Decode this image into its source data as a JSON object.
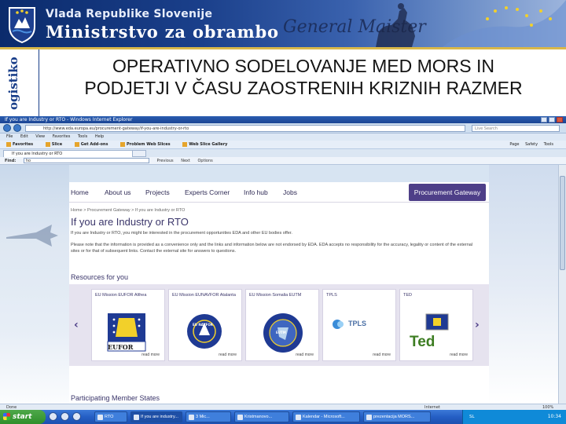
{
  "banner": {
    "government": "Vlada Republike Slovenije",
    "ministry": "Ministrstvo za obrambo",
    "general": "General Maister"
  },
  "slide": {
    "vertical_label": "ogistiko",
    "title_line1": "OPERATIVNO SODELOVANJE  MED MORS IN",
    "title_line2": "PODJETJI V ČASU ZAOSTRENIH KRIZNIH RAZMER"
  },
  "browser": {
    "window_title": "If you are Industry or RTO - Windows Internet Explorer",
    "url": "http://www.eda.europa.eu/procurement-gateway/if-you-are-industry-or-rto",
    "search_placeholder": "Live Search",
    "menu": [
      "File",
      "Edit",
      "View",
      "Favorites",
      "Tools",
      "Help"
    ],
    "favorites": [
      "Favorites",
      "Slice",
      "Get Add-ons",
      "Problem Web Slices",
      "Web Slice Gallery"
    ],
    "tools": [
      "Page",
      "Safety",
      "Tools"
    ],
    "tab_label": "If you are Industry or RTO",
    "find_label": "Find:",
    "find_value": "ho",
    "find_previous": "Previous",
    "find_next": "Next",
    "find_options": "Options",
    "status_text": "Done",
    "zone_text": "Internet",
    "zoom_text": "100%"
  },
  "eda": {
    "nav": [
      "Home",
      "About us",
      "Projects",
      "Experts Corner",
      "Info hub",
      "Jobs"
    ],
    "procurement_gateway": "Procurement Gateway",
    "breadcrumb": "Home  >  Procurement Gateway  >  If you are Industry or RTO",
    "heading": "If you are Industry or RTO",
    "intro": "If you are Industry or RTO, you might be interested in the procurement opportunities EDA and other EU bodies offer.",
    "body": "Please note that the information is provided as a convenience only and the links and information below are not endorsed by EDA. EDA accepts no responsibility for the accuracy, legality or content of the external sites or for that of subsequent links. Contact the external site for answers to questions.",
    "resources_heading": "Resources for you",
    "cards": [
      {
        "title": "EU Mission EUFOR Althea",
        "logo_text": "EUFOR",
        "more": "read more"
      },
      {
        "title": "EU Mission EUNAVFOR Atalanta",
        "logo_text": "EU NAVFOR",
        "more": "read more"
      },
      {
        "title": "EU Mission Somalia EUTM",
        "logo_text": "EUTM",
        "more": "read more"
      },
      {
        "title": "TPLS",
        "logo_text": "TPLS",
        "more": "read more"
      },
      {
        "title": "TED",
        "logo_text": "Ted",
        "more": "read more"
      }
    ],
    "participating_heading": "Participating Member States"
  },
  "taskbar": {
    "start": "start",
    "tasks": [
      "RTO",
      "If you are industry...",
      "3 Mic...",
      "Kristmanovo...",
      "Kalendar - Microsoft...",
      "prezentacija MORS..."
    ],
    "tray_text": "SL",
    "clock": "10:34"
  },
  "colors": {
    "banner_dark": "#0b2b6c",
    "eda_purple": "#4e3f88",
    "eda_text": "#3a356a",
    "xp_blue": "#245ec4",
    "xp_green": "#2f8f2b"
  }
}
